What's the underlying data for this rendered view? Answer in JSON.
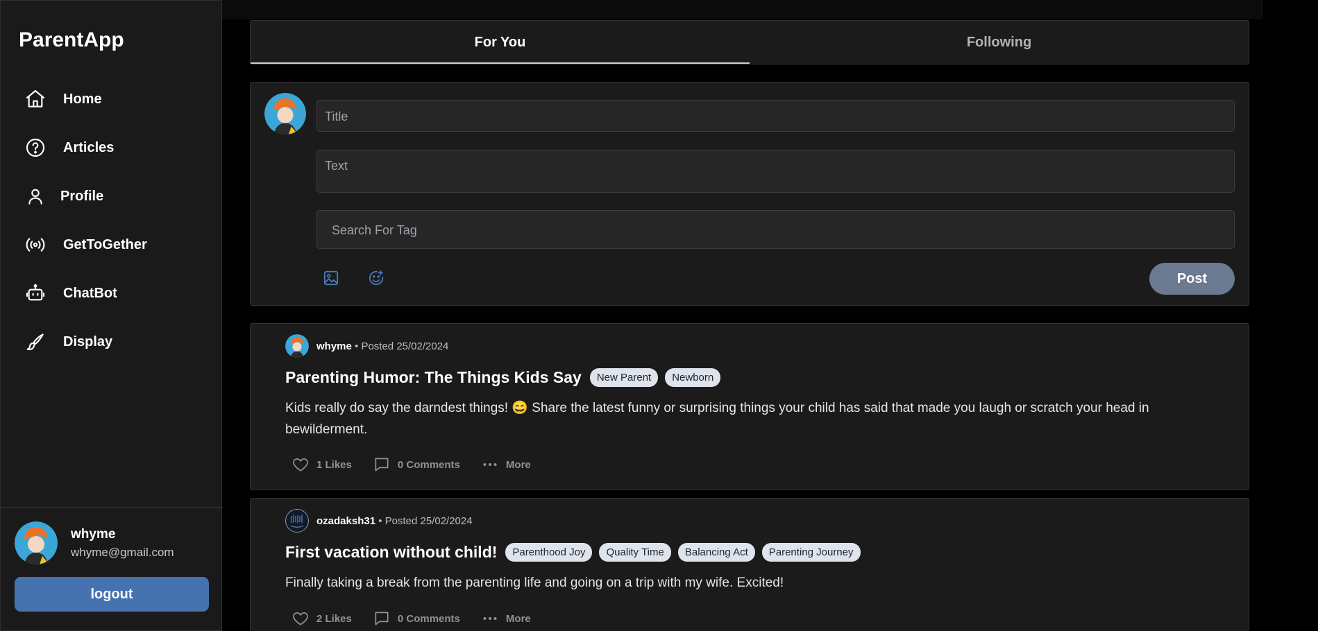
{
  "app": {
    "name": "ParentApp"
  },
  "nav": {
    "items": [
      {
        "label": "Home",
        "icon": "home-icon"
      },
      {
        "label": "Articles",
        "icon": "help-circle-icon"
      },
      {
        "label": "Profile",
        "icon": "user-icon"
      },
      {
        "label": "GetToGether",
        "icon": "broadcast-icon"
      },
      {
        "label": "ChatBot",
        "icon": "robot-icon"
      },
      {
        "label": "Display",
        "icon": "brush-icon"
      }
    ]
  },
  "user": {
    "name": "whyme",
    "email": "whyme@gmail.com",
    "logout_label": "logout"
  },
  "tabs": {
    "for_you": "For You",
    "following": "Following",
    "active": "For You"
  },
  "composer": {
    "title_placeholder": "Title",
    "text_placeholder": "Text",
    "tag_placeholder": "Search For Tag",
    "post_label": "Post",
    "tools": [
      "image-icon",
      "emoji-add-icon"
    ]
  },
  "posts": [
    {
      "author": "whyme",
      "posted": "• Posted 25/02/2024",
      "title": "Parenting Humor: The Things Kids Say",
      "tags": [
        "New Parent",
        "Newborn"
      ],
      "body": "Kids really do say the darndest things! 😄 Share the latest funny or surprising things your child has said that made you laugh or scratch your head in bewilderment.",
      "likes": "1 Likes",
      "comments": "0 Comments",
      "more": "More"
    },
    {
      "author": "ozadaksh31",
      "posted": "• Posted 25/02/2024",
      "title": "First vacation without child!",
      "tags": [
        "Parenthood Joy",
        "Quality Time",
        "Balancing Act",
        "Parenting Journey"
      ],
      "body": "Finally taking a break from the parenting life and going on a trip with my wife. Excited!",
      "likes": "2 Likes",
      "comments": "0 Comments",
      "more": "More"
    }
  ],
  "colors": {
    "background": "#000000",
    "panel": "#1b1b1b",
    "accent_button": "#4673b0",
    "post_button": "#6b7a91",
    "tag_chip": "#dfe4ec",
    "tool_icon": "#4a7fc1"
  }
}
